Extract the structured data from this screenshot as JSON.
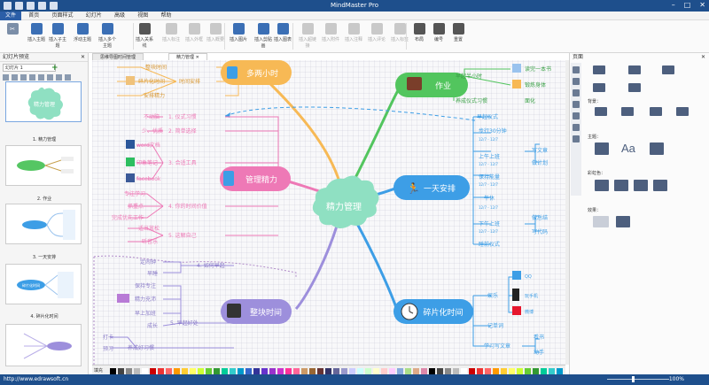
{
  "window": {
    "title": "MindMaster Pro"
  },
  "menu": {
    "items": [
      "文件",
      "首页",
      "页面样式",
      "幻灯片",
      "高级",
      "视图",
      "帮助"
    ]
  },
  "ribbon": {
    "buttons": [
      {
        "label": "插入主题",
        "color": "#3b6fb5",
        "disabled": false
      },
      {
        "label": "插入子主题",
        "color": "#3b6fb5",
        "disabled": false
      },
      {
        "label": "浮动主题",
        "color": "#3b6fb5",
        "disabled": false
      },
      {
        "label": "插入多个主题",
        "color": "#3b6fb5",
        "disabled": false
      },
      {
        "label": "插入关系线",
        "color": "#555",
        "disabled": false
      },
      {
        "label": "插入标注",
        "color": "#555",
        "disabled": true
      },
      {
        "label": "插入外框",
        "color": "#555",
        "disabled": true
      },
      {
        "label": "插入概要",
        "color": "#555",
        "disabled": true
      },
      {
        "label": "插入图片",
        "color": "#3b6fb5",
        "disabled": false
      },
      {
        "label": "插入剪贴画",
        "color": "#3b6fb5",
        "disabled": false
      },
      {
        "label": "插入图表",
        "color": "#3b6fb5",
        "disabled": false
      },
      {
        "label": "插入超链接",
        "color": "#555",
        "disabled": true
      },
      {
        "label": "插入附件",
        "color": "#555",
        "disabled": true
      },
      {
        "label": "插入注释",
        "color": "#555",
        "disabled": true
      },
      {
        "label": "插入评论",
        "color": "#555",
        "disabled": true
      },
      {
        "label": "插入标签",
        "color": "#555",
        "disabled": true
      },
      {
        "label": "布局",
        "color": "#555",
        "disabled": false
      },
      {
        "label": "编号",
        "color": "#555",
        "disabled": false
      },
      {
        "label": "重置",
        "color": "#555",
        "disabled": false
      }
    ]
  },
  "left_panel": {
    "title": "幻灯片预览",
    "close": "✕",
    "dropdown": "幻灯片 1",
    "add": "+",
    "slides": [
      {
        "caption": "1. 精力管理",
        "label": "精力管理"
      },
      {
        "caption": "2. 作业",
        "label": ""
      },
      {
        "caption": "3. 一天安排",
        "label": ""
      },
      {
        "caption": "4. 碎片化时间",
        "label": "碎片化时间"
      },
      {
        "caption": "",
        "label": ""
      }
    ]
  },
  "tabs": [
    {
      "label": "思维导图时间管理"
    },
    {
      "label": "精力管理"
    }
  ],
  "mindmap": {
    "central": "精力管理",
    "topics": {
      "duoliang": "多两小时",
      "zuoye": "作业",
      "guanli": "管理精力",
      "yitian": "一天安排",
      "suipian": "碎片化时间",
      "zhengkuai": "整块时间"
    },
    "items": {
      "dk1": "整块时间",
      "dk2": "碎片化时间",
      "dk3": "安排精力",
      "dk_mid": "时间安排",
      "zy1": "早起半小时",
      "zy2": "读完一本书",
      "zy3": "锻炼身体",
      "zy4": "养成仪式习惯",
      "zy5": "面化",
      "gl1": "1. 仪式习惯",
      "gl1a": "不动脑",
      "gl2": "2. 简单选择",
      "gl2a": "少、优质",
      "gl3": "3. 合适工具",
      "gl3a": "word文档",
      "gl3b": "印象笔记",
      "gl3c": "facebook",
      "gl4": "4. 你的时间价值",
      "gl4a": "专注学习",
      "gl4b": "抓重点",
      "gl4c": "完成优先工作",
      "gl5": "5. 这解自己",
      "gl5a": "适当放松",
      "gl5b": "听音乐",
      "yt1": "早起仪式",
      "yt2": "步行30分钟",
      "yt2t": "12/7 - 12/7",
      "yt3": "上午上班",
      "yt3a": "写文章",
      "yt3b": "做计划",
      "yt4": "保持能量",
      "yt5": "午休",
      "yt6": "下午上班",
      "yt6a": "做总结",
      "yt6b": "写代码",
      "yt7": "睡前仪式",
      "sp1": "娱乐",
      "sp1a": "QQ",
      "sp1b": "玩手机",
      "sp1c": "微博",
      "sp2": "记单词",
      "sp3": "学习写文章",
      "sp3a": "看书",
      "sp3b": "动手",
      "zk1": "4. 如何早起",
      "zk1a": "定闹钟",
      "zk1b": "早睡",
      "zk2": "5. 早起好处",
      "zk2a": "保持专注",
      "zk2b": "精力充沛",
      "zk2c": "早上加班",
      "zk2d": "成长",
      "zk3": "养成好习惯",
      "zk3a": "打卡",
      "zk3b": "预习"
    }
  },
  "right_panel": {
    "title": "页面",
    "sections": {
      "background": "背景：",
      "theme": "主题：",
      "color": "彩虹色：",
      "effect": "效果："
    },
    "theme_text": "Aa"
  },
  "palette": {
    "label": "填充"
  },
  "status": {
    "url": "http://www.edrawsoft.cn",
    "zoom": "100%"
  },
  "colors": {
    "titlebar": "#1e4f8c",
    "orange": "#f7b955",
    "green": "#52c55e",
    "pink": "#ee79b6",
    "blue": "#3d9ee6",
    "purple": "#9d8fdc",
    "central": "#8fe0c2"
  }
}
